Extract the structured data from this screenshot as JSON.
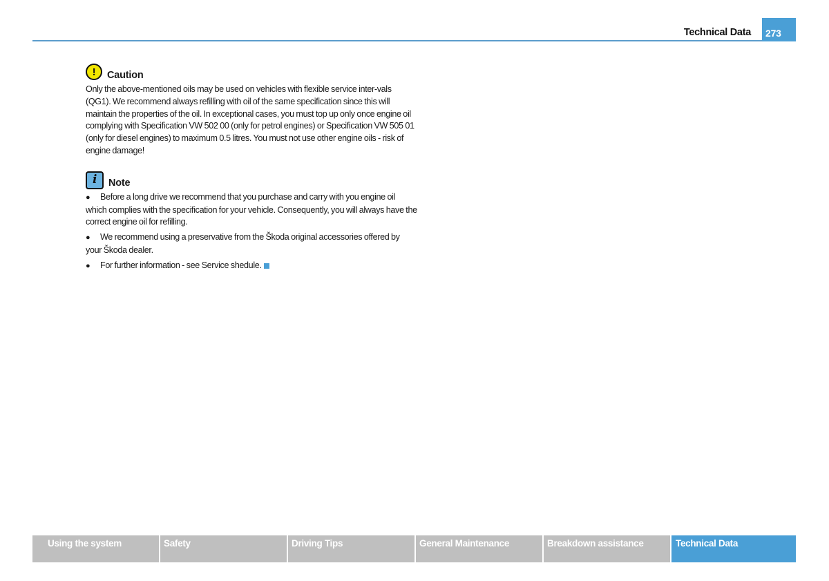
{
  "header": {
    "section_title": "Technical Data",
    "page_number": "273",
    "accent_color": "#4a9fd6"
  },
  "caution": {
    "icon": "exclamation-circle-icon",
    "title": "Caution",
    "text": "Only the above-mentioned oils may be used on vehicles with flexible service inter-vals (QG1). We recommend always refilling with oil of the same specification since this will maintain the properties of the oil. In exceptional cases, you must top up only once engine oil complying with Specification VW 502 00 (only for petrol engines) or Specification VW 505 01 (only for diesel engines) to maximum 0.5 litres. You must not use other engine oils - risk of engine damage!"
  },
  "note": {
    "icon": "info-icon",
    "title": "Note",
    "bullets": [
      "Before a long drive we recommend that you purchase and carry with you engine oil which complies with the specification for your vehicle. Consequently, you will always have the correct engine oil for refilling.",
      "We recommend using a preservative from the Škoda original accessories offered by your Škoda dealer.",
      "For further information - see Service shedule."
    ],
    "bullet_glyph": "●"
  },
  "footer": {
    "tabs": [
      {
        "label": "Using the system",
        "active": false
      },
      {
        "label": "Safety",
        "active": false
      },
      {
        "label": "Driving Tips",
        "active": false
      },
      {
        "label": "General Maintenance",
        "active": false
      },
      {
        "label": "Breakdown assistance",
        "active": false
      },
      {
        "label": "Technical Data",
        "active": true
      }
    ],
    "inactive_color": "#bfbfbf",
    "active_color": "#4a9fd6"
  }
}
